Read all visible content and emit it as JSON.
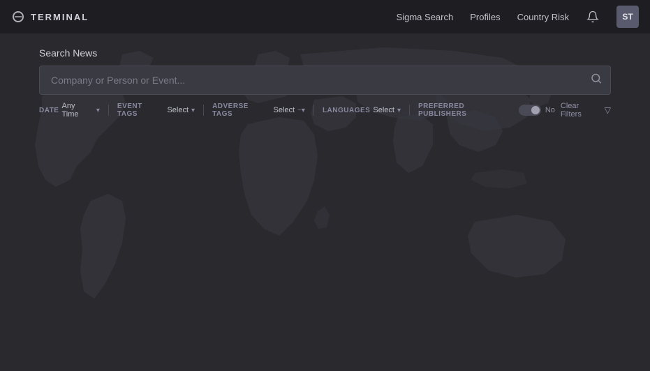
{
  "navbar": {
    "logo_text": "TERMINAL",
    "links": [
      {
        "id": "sigma-search",
        "label": "Sigma Search"
      },
      {
        "id": "profiles",
        "label": "Profiles"
      },
      {
        "id": "country-risk",
        "label": "Country Risk"
      }
    ],
    "avatar_initials": "ST"
  },
  "main": {
    "search_title": "Search News",
    "search_placeholder": "Company or Person or Event...",
    "filters": {
      "date_label": "DATE",
      "date_value": "Any Time",
      "event_tags_label": "EVENT TAGS",
      "event_tags_value": "Select",
      "adverse_tags_label": "ADVERSE TAGS",
      "adverse_tags_value": "Select",
      "languages_label": "LANGUAGES",
      "languages_value": "Select",
      "preferred_publishers_label": "PREFERRED PUBLISHERS",
      "preferred_publishers_toggle": "No"
    },
    "clear_filters_label": "Clear Filters"
  }
}
